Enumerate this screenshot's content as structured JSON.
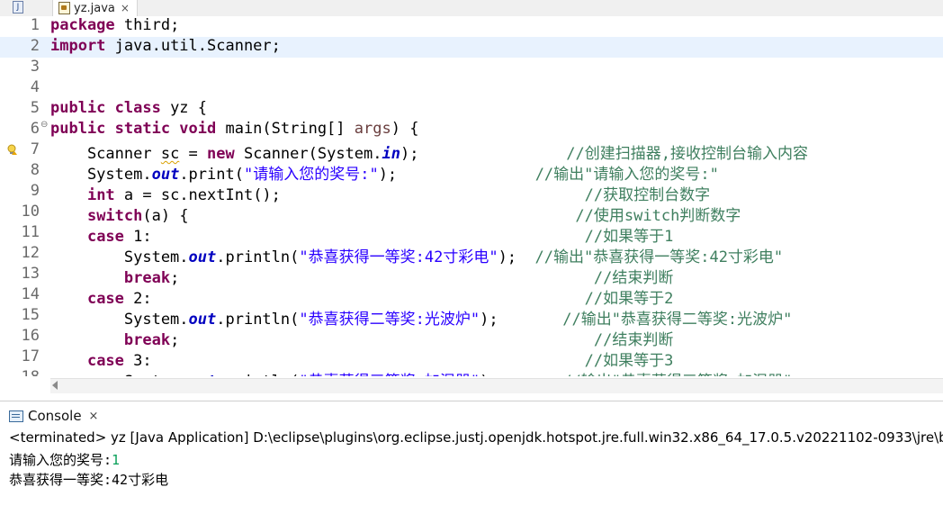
{
  "editor_tab": {
    "label": "yz.java",
    "close": "×"
  },
  "code_lines": [
    {
      "n": "1",
      "html": "<span class=\"kw\">package</span> third;"
    },
    {
      "n": "2",
      "html": "<span class=\"kw\">import</span> java.util.Scanner;"
    },
    {
      "n": "3",
      "html": ""
    },
    {
      "n": "4",
      "html": ""
    },
    {
      "n": "5",
      "html": "<span class=\"kw\">public class</span> yz {"
    },
    {
      "n": "6",
      "html": "<span class=\"kw\">public static void</span> main(String[] <span class=\"unused\">args</span>) {"
    },
    {
      "n": "7",
      "html": "    Scanner <span class=\"squig\">sc</span> = <span class=\"kw\">new</span> Scanner(System.<span class=\"fld\">in</span>);                <span class=\"cmt\">//创建扫描器,接收控制台输入内容</span>"
    },
    {
      "n": "8",
      "html": "    System.<span class=\"fld\">out</span>.print(<span class=\"str\">\"请输入您的奖号:\"</span>);               <span class=\"cmt\">//输出\"请输入您的奖号:\"</span>"
    },
    {
      "n": "9",
      "html": "    <span class=\"kw\">int</span> a = sc.nextInt();                                 <span class=\"cmt\">//获取控制台数字</span>"
    },
    {
      "n": "10",
      "html": "    <span class=\"kw\">switch</span>(a) {                                          <span class=\"cmt\">//使用switch判断数字</span>"
    },
    {
      "n": "11",
      "html": "    <span class=\"kw\">case</span> 1:                                               <span class=\"cmt\">//如果等于1</span>"
    },
    {
      "n": "12",
      "html": "        System.<span class=\"fld\">out</span>.println(<span class=\"str\">\"恭喜获得一等奖:42寸彩电\"</span>);  <span class=\"cmt\">//输出\"恭喜获得一等奖:42寸彩电\"</span>"
    },
    {
      "n": "13",
      "html": "        <span class=\"kw\">break</span>;                                             <span class=\"cmt\">//结束判断</span>"
    },
    {
      "n": "14",
      "html": "    <span class=\"kw\">case</span> 2:                                               <span class=\"cmt\">//如果等于2</span>"
    },
    {
      "n": "15",
      "html": "        System.<span class=\"fld\">out</span>.println(<span class=\"str\">\"恭喜获得二等奖:光波炉\"</span>);       <span class=\"cmt\">//输出\"恭喜获得二等奖:光波炉\"</span>"
    },
    {
      "n": "16",
      "html": "        <span class=\"kw\">break</span>;                                             <span class=\"cmt\">//结束判断</span>"
    },
    {
      "n": "17",
      "html": "    <span class=\"kw\">case</span> 3:                                               <span class=\"cmt\">//如果等于3</span>"
    },
    {
      "n": "18",
      "html": "        System.<span class=\"fld\">out</span>.println(<span class=\"str\">\"恭喜获得三等奖:加湿器\"</span>);       <span class=\"cmt\">//输出\"恭喜获得三等奖:加湿器\"</span>"
    }
  ],
  "console": {
    "tab_label": "Console",
    "close": "×",
    "header": "<terminated> yz [Java Application] D:\\eclipse\\plugins\\org.eclipse.justj.openjdk.hotspot.jre.full.win32.x86_64_17.0.5.v20221102-0933\\jre\\bin\\javaw.exe",
    "prompt": "请输入您的奖号:",
    "input_value": "1",
    "output": "恭喜获得一等奖:42寸彩电"
  },
  "icons": {
    "tab_file": "java-file-icon",
    "console": "console-icon",
    "warning": "warning-bulb-icon",
    "fold": "fold-collapse-icon"
  },
  "colors": {
    "keyword": "#7f0055",
    "string": "#2a00ff",
    "comment": "#3f7f5f",
    "field": "#0000c0",
    "current_line": "#e8f2fe",
    "console_input": "#0aa05a"
  }
}
